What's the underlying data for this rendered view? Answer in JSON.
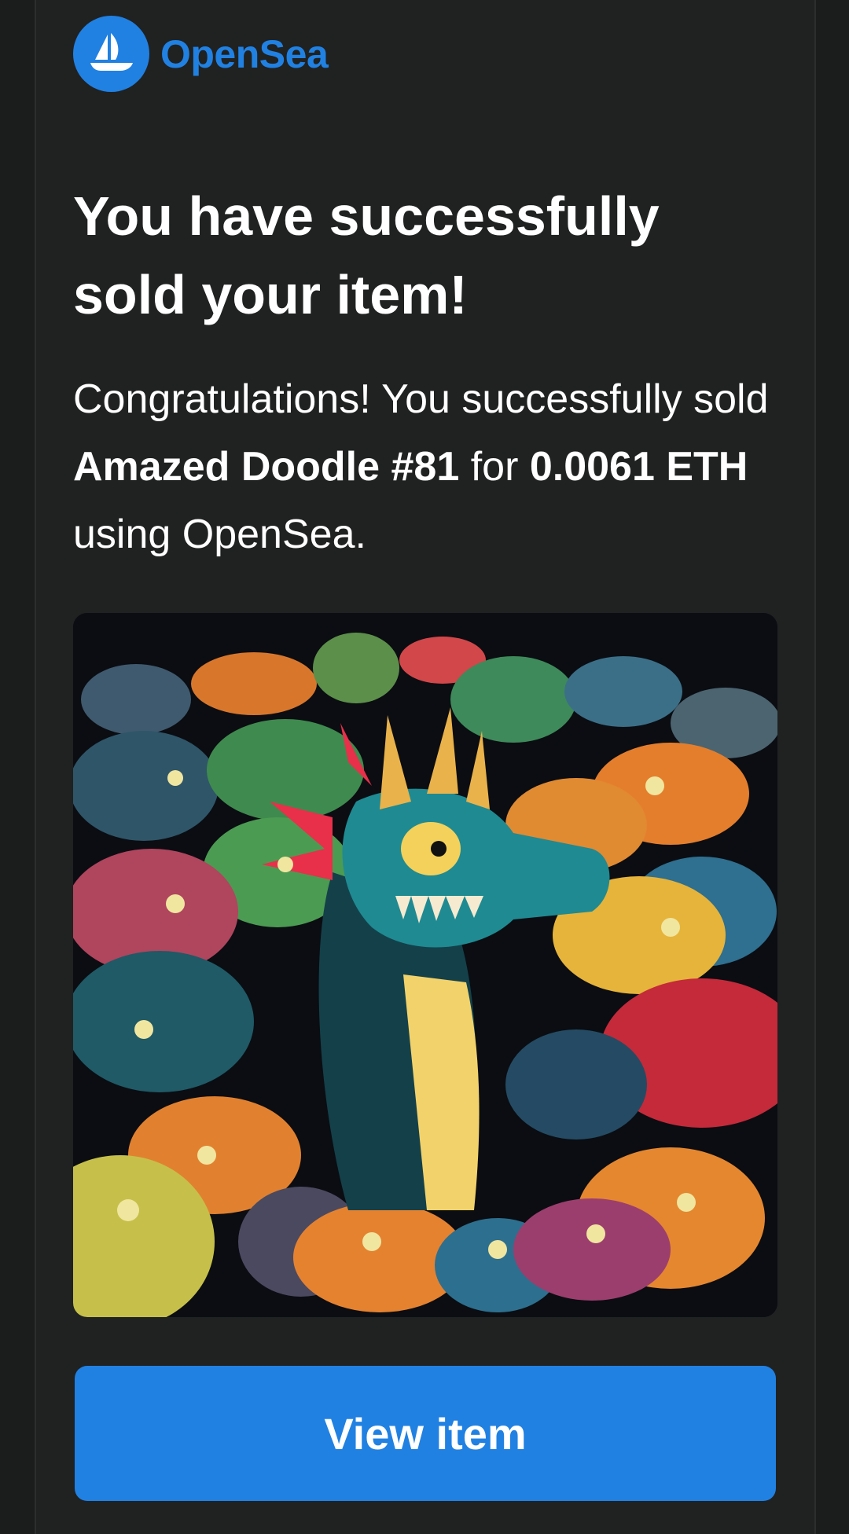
{
  "brand": {
    "name": "OpenSea",
    "color": "#2081e2",
    "logo_icon": "ship-icon"
  },
  "email": {
    "title": "You have successfully sold your item!",
    "message_prefix": "Congratulations! You successfully sold ",
    "item_name": "Amazed Doodle #81",
    "message_middle": " for ",
    "price": "0.0061 ETH",
    "message_suffix": " using OpenSea."
  },
  "artwork": {
    "description_icon": "nft-artwork-image"
  },
  "cta": {
    "label": "View item"
  }
}
